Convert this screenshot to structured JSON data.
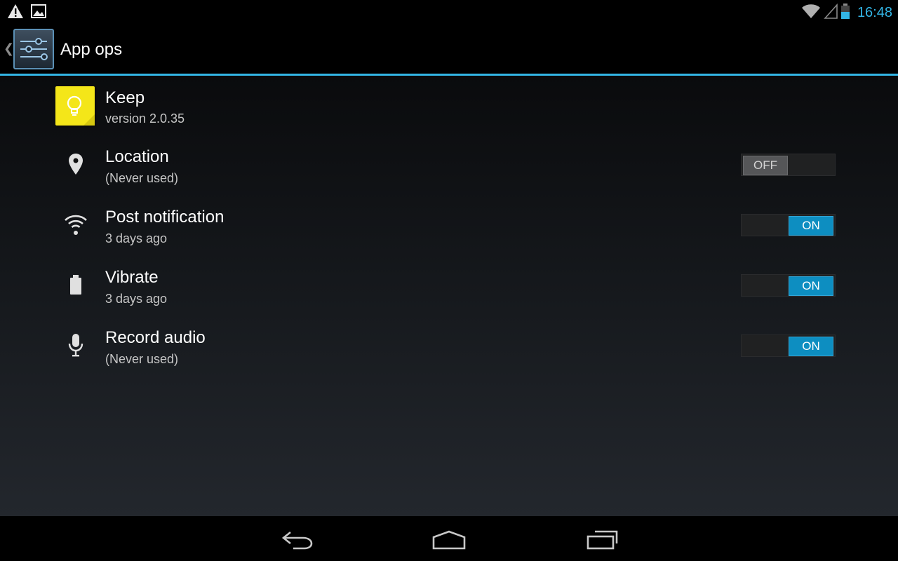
{
  "status_bar": {
    "left_icons": [
      "warning-icon",
      "image-icon"
    ],
    "right_icons": [
      "wifi-icon",
      "cell-signal-icon",
      "battery-icon"
    ],
    "time": "16:48",
    "accent": "#33b5e5"
  },
  "action_bar": {
    "title": "App ops",
    "icon": "settings-sliders-icon"
  },
  "app": {
    "name": "Keep",
    "version": "version 2.0.35",
    "icon": "keep-lightbulb-icon",
    "icon_color": "#f4e619"
  },
  "ops": [
    {
      "icon": "location-pin-icon",
      "title": "Location",
      "subtitle": "(Never used)",
      "state": "OFF"
    },
    {
      "icon": "wifi-notification-icon",
      "title": "Post notification",
      "subtitle": "3 days ago",
      "state": "ON"
    },
    {
      "icon": "battery-vibrate-icon",
      "title": "Vibrate",
      "subtitle": "3 days ago",
      "state": "ON"
    },
    {
      "icon": "microphone-icon",
      "title": "Record audio",
      "subtitle": "(Never used)",
      "state": "ON"
    }
  ],
  "nav_bar": {
    "buttons": [
      "back-icon",
      "home-icon",
      "recents-icon"
    ]
  },
  "colors": {
    "switch_on": "#0d8ec1",
    "switch_off": "#555658"
  }
}
